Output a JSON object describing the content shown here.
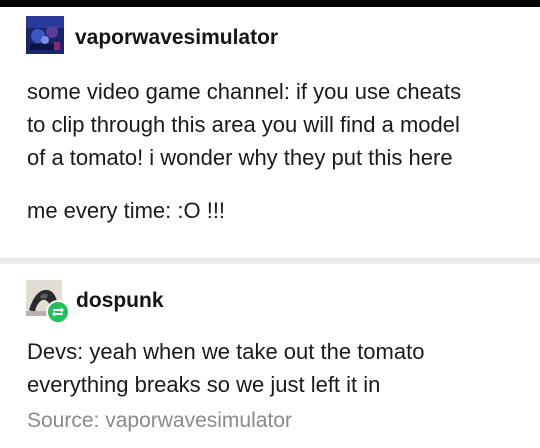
{
  "posts": [
    {
      "username": "vaporwavesimulator",
      "paragraphs": [
        [
          "some video game channel: if you use cheats",
          "to clip through this area you will find a model",
          "of a tomato! i wonder why they put this here"
        ],
        [
          "me every time: :O !!!"
        ]
      ]
    },
    {
      "username": "dospunk",
      "paragraphs": [
        [
          "Devs: yeah when we take out the tomato",
          "everything breaks so we just left it in"
        ]
      ]
    }
  ],
  "source": "Source: vaporwavesimulator",
  "colors": {
    "text": "#1a1a1a",
    "source_text": "#8a8a8a",
    "reblog_badge": "#1fbf5b",
    "background": "#ffffff"
  },
  "icons": [
    "avatar-vaporwavesimulator",
    "avatar-dospunk",
    "reblog-icon"
  ]
}
